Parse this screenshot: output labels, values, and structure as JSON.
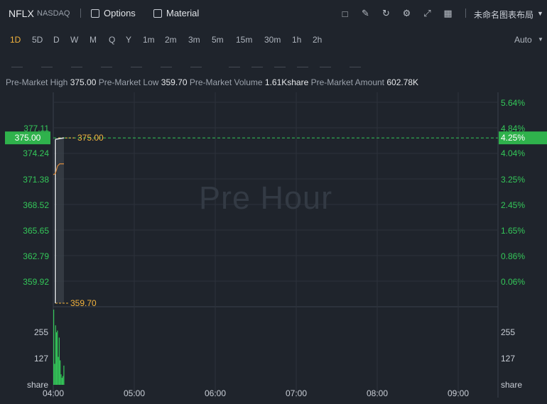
{
  "header": {
    "symbol": "NFLX",
    "exchange": "NASDAQ",
    "options_label": "Options",
    "material_label": "Material",
    "layout_name": "未命名图表布局",
    "icons": [
      "chart-icon",
      "edit-icon",
      "refresh-icon",
      "settings-icon",
      "fullscreen-icon",
      "grid-icon"
    ]
  },
  "periods": {
    "items": [
      "1D",
      "5D",
      "D",
      "W",
      "M",
      "Q",
      "Y",
      "1m",
      "2m",
      "3m",
      "5m",
      "15m",
      "30m",
      "1h",
      "2h"
    ],
    "active": "1D",
    "scale_mode": "Auto"
  },
  "info": {
    "high_label": "Pre-Market High",
    "high_value": "375.00",
    "low_label": "Pre-Market Low",
    "low_value": "359.70",
    "volume_label": "Pre-Market Volume",
    "volume_value": "1.61Kshare",
    "amount_label": "Pre-Market Amount",
    "amount_value": "602.78K"
  },
  "watermark": "Pre Hour",
  "chart_data": {
    "type": "line",
    "price_ticks": [
      "377.11",
      "374.24",
      "371.38",
      "368.52",
      "365.65",
      "362.79",
      "359.92"
    ],
    "percent_ticks": [
      "5.64%",
      "4.84%",
      "4.04%",
      "3.25%",
      "2.45%",
      "1.65%",
      "0.86%",
      "0.06%"
    ],
    "x_ticks": [
      "04:00",
      "05:00",
      "06:00",
      "07:00",
      "08:00",
      "09:00"
    ],
    "volume_ticks": [
      "255",
      "127"
    ],
    "volume_unit": "share",
    "current_price": "375.00",
    "current_percent": "4.25%",
    "high_marker": "375.00",
    "low_marker": "359.70",
    "ylim": [
      359.5,
      378.3
    ],
    "price_series": [
      [
        0,
        371.6
      ],
      [
        0.5,
        371.7
      ],
      [
        1,
        372.4
      ],
      [
        1.5,
        372.6
      ],
      [
        2.5,
        372.6
      ]
    ],
    "volume_series": [
      430,
      120,
      340,
      300,
      310,
      160,
      270,
      140,
      60,
      40,
      50,
      110
    ],
    "colors": {
      "accent": "#f3b33d",
      "up": "#34c759",
      "price_badge": "#2fb24c",
      "price_line": "#e0e3e7",
      "avg_line": "#d98a3d"
    }
  }
}
